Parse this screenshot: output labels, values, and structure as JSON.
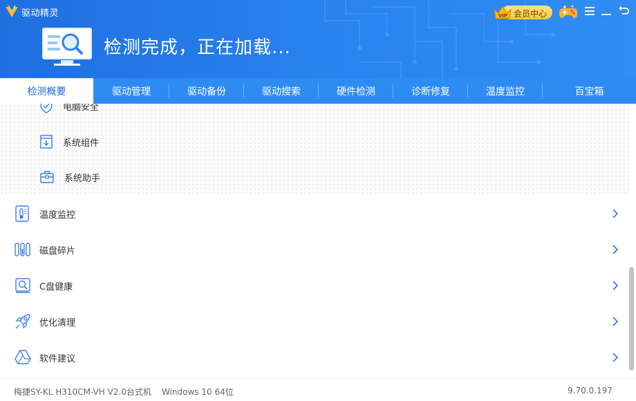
{
  "window": {
    "app_name": "驱动精灵"
  },
  "header": {
    "status_title": "检测完成，正在加载...",
    "vip_label": "会员中心",
    "vip_badge": "VIP"
  },
  "tabs": [
    {
      "label": "检测概要",
      "active": true
    },
    {
      "label": "驱动管理",
      "active": false
    },
    {
      "label": "驱动备份",
      "active": false
    },
    {
      "label": "驱动搜索",
      "active": false
    },
    {
      "label": "硬件检测",
      "active": false
    },
    {
      "label": "诊断修复",
      "active": false
    },
    {
      "label": "温度监控",
      "active": false
    },
    {
      "label": "百宝箱",
      "active": false
    }
  ],
  "sub_items": [
    {
      "label": "电脑安全",
      "icon": "shield-icon"
    },
    {
      "label": "系统组件",
      "icon": "download-box-icon"
    },
    {
      "label": "系统助手",
      "icon": "toolbox-icon"
    }
  ],
  "rows": [
    {
      "label": "温度监控",
      "icon": "thermometer-icon"
    },
    {
      "label": "磁盘碎片",
      "icon": "disk-fragment-icon"
    },
    {
      "label": "C盘健康",
      "icon": "disk-health-icon"
    },
    {
      "label": "优化清理",
      "icon": "rocket-icon"
    },
    {
      "label": "软件建议",
      "icon": "software-icon"
    }
  ],
  "footer": {
    "machine": "梅捷SY-KL H310CM-VH V2.0台式机",
    "os": "Windows 10 64位",
    "version": "9.70.0.197"
  },
  "colors": {
    "header_blue": "#2a83f0",
    "tab_bar": "#2e8bf2",
    "accent": "#3a7ee6"
  }
}
